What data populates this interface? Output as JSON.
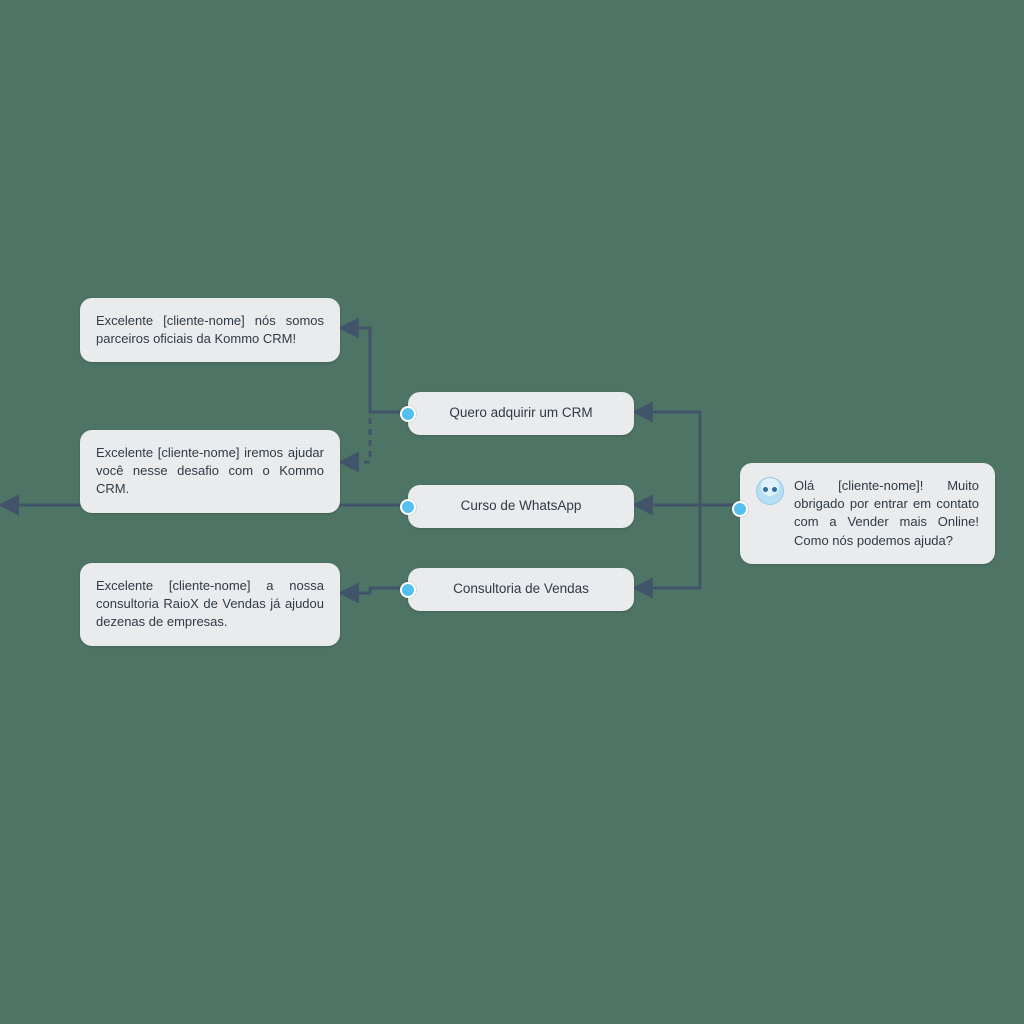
{
  "greeting": {
    "text": "Olá [cliente-nome]! Muito obrigado por entrar em contato com a Vender mais Online! Como nós podemos ajuda?"
  },
  "options": {
    "crm": {
      "label": "Quero adquirir um CRM"
    },
    "whatsapp": {
      "label": "Curso de WhatsApp"
    },
    "consultoria": {
      "label": "Consultoria de Vendas"
    }
  },
  "responses": {
    "crm1": "Excelente [cliente-nome] nós somos parceiros oficiais da Kommo CRM!",
    "crm2": "Excelente [cliente-nome] iremos ajudar você nesse desafio com o Kommo CRM.",
    "consultoria": "Excelente [cliente-nome] a nossa consultoria RaioX de Vendas já ajudou dezenas de empresas."
  },
  "colors": {
    "background": "#4d7464",
    "card": "#e9ebed",
    "connector": "#42546a",
    "port": "#55c0f0"
  }
}
